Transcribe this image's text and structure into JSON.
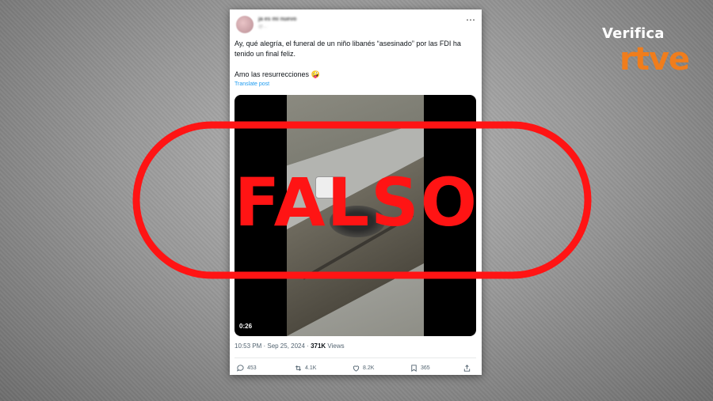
{
  "brand": {
    "top": "Verifica",
    "bottom": "rtve"
  },
  "tweet": {
    "author_name": "ja es mi nuevo",
    "author_handle": "@...",
    "text_line1": "Ay, qué alegría, el funeral de un niño libanés “asesinado” por las FDI ha tenido un final feliz.",
    "text_line2": "Amo las resurrecciones 🤪",
    "translate": "Translate post",
    "video_time": "0:26",
    "timestamp": "10:53 PM · Sep 25, 2024 · ",
    "views_count": "371K",
    "views_label": " Views",
    "actions": {
      "replies": "453",
      "reposts": "4.1K",
      "likes": "8.2K",
      "bookmarks": "365"
    }
  },
  "stamp": {
    "label": "FALSO",
    "color": "#ff1414"
  },
  "icons": [
    "more-icon",
    "reply-icon",
    "repost-icon",
    "like-icon",
    "bookmark-icon",
    "share-icon"
  ]
}
